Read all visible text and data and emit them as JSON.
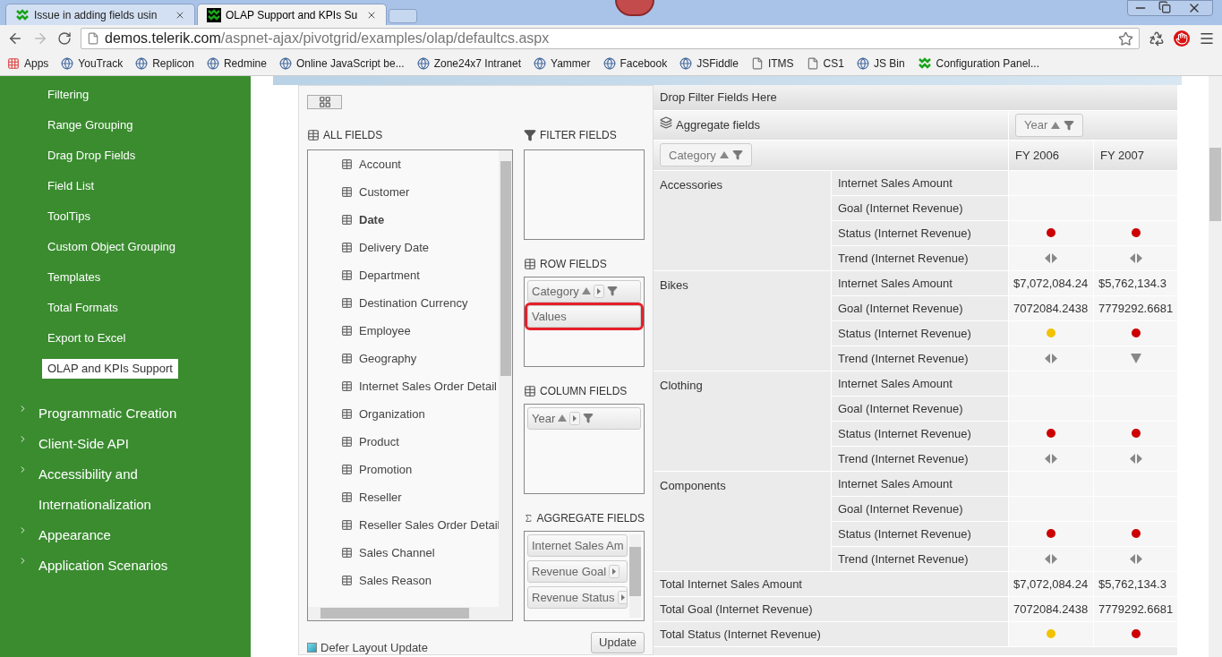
{
  "browser": {
    "tabs": [
      {
        "title": "Issue in adding fields usin",
        "selected": false
      },
      {
        "title": "OLAP Support and KPIs Su",
        "selected": true
      }
    ],
    "url_host": "demos.telerik.com",
    "url_path": "/aspnet-ajax/pivotgrid/examples/olap/defaultcs.aspx",
    "bookmarks": [
      {
        "label": "Apps",
        "kind": "apps"
      },
      {
        "label": "YouTrack",
        "kind": "site"
      },
      {
        "label": "Replicon",
        "kind": "site"
      },
      {
        "label": "Redmine",
        "kind": "site"
      },
      {
        "label": "Online JavaScript be...",
        "kind": "site"
      },
      {
        "label": "Zone24x7 Intranet",
        "kind": "site"
      },
      {
        "label": "Yammer",
        "kind": "site"
      },
      {
        "label": "Facebook",
        "kind": "site"
      },
      {
        "label": "JSFiddle",
        "kind": "site"
      },
      {
        "label": "ITMS",
        "kind": "page"
      },
      {
        "label": "CS1",
        "kind": "page"
      },
      {
        "label": "JS Bin",
        "kind": "site"
      },
      {
        "label": "Configuration Panel...",
        "kind": "logo"
      }
    ]
  },
  "sidebar": {
    "items": [
      {
        "label": "Filtering",
        "selected": false
      },
      {
        "label": "Range Grouping",
        "selected": false
      },
      {
        "label": "Drag Drop Fields",
        "selected": false
      },
      {
        "label": "Field List",
        "selected": false
      },
      {
        "label": "ToolTips",
        "selected": false
      },
      {
        "label": "Custom Object Grouping",
        "selected": false
      },
      {
        "label": "Templates",
        "selected": false
      },
      {
        "label": "Total Formats",
        "selected": false
      },
      {
        "label": "Export to Excel",
        "selected": false
      },
      {
        "label": "OLAP and KPIs Support",
        "selected": true
      }
    ],
    "sections": [
      {
        "label": "Programmatic Creation",
        "expanded": false
      },
      {
        "label": "Client-Side API",
        "expanded": false
      },
      {
        "label": "Accessibility and Internationalization",
        "expanded": false
      },
      {
        "label": "Appearance",
        "expanded": false
      },
      {
        "label": "Application Scenarios",
        "expanded": false
      }
    ]
  },
  "field_list": {
    "all_fields_title": "ALL FIELDS",
    "all_fields": [
      {
        "label": "Account",
        "bold": false
      },
      {
        "label": "Customer",
        "bold": false
      },
      {
        "label": "Date",
        "bold": true
      },
      {
        "label": "Delivery Date",
        "bold": false
      },
      {
        "label": "Department",
        "bold": false
      },
      {
        "label": "Destination Currency",
        "bold": false
      },
      {
        "label": "Employee",
        "bold": false
      },
      {
        "label": "Geography",
        "bold": false
      },
      {
        "label": "Internet Sales Order Detail",
        "bold": false
      },
      {
        "label": "Organization",
        "bold": false
      },
      {
        "label": "Product",
        "bold": false
      },
      {
        "label": "Promotion",
        "bold": false
      },
      {
        "label": "Reseller",
        "bold": false
      },
      {
        "label": "Reseller Sales Order Detail",
        "bold": false
      },
      {
        "label": "Sales Channel",
        "bold": false
      },
      {
        "label": "Sales Reason",
        "bold": false
      }
    ],
    "filter_title": "FILTER FIELDS",
    "row_title": "ROW FIELDS",
    "row_fields": [
      {
        "label": "Category",
        "kind": "field",
        "highlighted": false
      },
      {
        "label": "Values",
        "kind": "values",
        "highlighted": true
      }
    ],
    "column_title": "COLUMN FIELDS",
    "column_fields": [
      {
        "label": "Year",
        "kind": "field",
        "highlighted": false
      }
    ],
    "aggregate_title": "AGGREGATE FIELDS",
    "aggregate_fields": [
      {
        "label": "Internet Sales Am",
        "kind": "plain"
      },
      {
        "label": "Revenue Goal",
        "kind": "field"
      },
      {
        "label": "Revenue Status",
        "kind": "field"
      }
    ],
    "defer": {
      "label": "Defer Layout Update",
      "checked": false
    },
    "update_button": "Update"
  },
  "pivot": {
    "filter_zone": "Drop Filter Fields Here",
    "aggregate_label": "Aggregate fields",
    "column_field": "Year",
    "row_field": "Category",
    "columns": [
      "FY 2006",
      "FY 2007"
    ],
    "groups": [
      {
        "label": "Accessories",
        "rows": [
          {
            "measure": "Internet Sales Amount",
            "cells": [
              {
                "kind": "empty"
              },
              {
                "kind": "empty"
              }
            ]
          },
          {
            "measure": "Goal (Internet Revenue)",
            "cells": [
              {
                "kind": "empty"
              },
              {
                "kind": "empty"
              }
            ]
          },
          {
            "measure": "Status (Internet Revenue)",
            "cells": [
              {
                "kind": "status",
                "color": "#cc0000"
              },
              {
                "kind": "status",
                "color": "#cc0000"
              }
            ]
          },
          {
            "measure": "Trend (Internet Revenue)",
            "cells": [
              {
                "kind": "flat"
              },
              {
                "kind": "flat"
              }
            ]
          }
        ]
      },
      {
        "label": "Bikes",
        "rows": [
          {
            "measure": "Internet Sales Amount",
            "cells": [
              {
                "kind": "text",
                "text": "$7,072,084.24"
              },
              {
                "kind": "text",
                "text": "$5,762,134.3"
              }
            ]
          },
          {
            "measure": "Goal (Internet Revenue)",
            "cells": [
              {
                "kind": "text",
                "text": "7072084.2438"
              },
              {
                "kind": "text",
                "text": "7779292.6681"
              }
            ]
          },
          {
            "measure": "Status (Internet Revenue)",
            "cells": [
              {
                "kind": "status",
                "color": "#f2c200"
              },
              {
                "kind": "status",
                "color": "#cc0000"
              }
            ]
          },
          {
            "measure": "Trend (Internet Revenue)",
            "cells": [
              {
                "kind": "flat"
              },
              {
                "kind": "down"
              }
            ]
          }
        ]
      },
      {
        "label": "Clothing",
        "rows": [
          {
            "measure": "Internet Sales Amount",
            "cells": [
              {
                "kind": "empty"
              },
              {
                "kind": "empty"
              }
            ]
          },
          {
            "measure": "Goal (Internet Revenue)",
            "cells": [
              {
                "kind": "empty"
              },
              {
                "kind": "empty"
              }
            ]
          },
          {
            "measure": "Status (Internet Revenue)",
            "cells": [
              {
                "kind": "status",
                "color": "#cc0000"
              },
              {
                "kind": "status",
                "color": "#cc0000"
              }
            ]
          },
          {
            "measure": "Trend (Internet Revenue)",
            "cells": [
              {
                "kind": "flat"
              },
              {
                "kind": "flat"
              }
            ]
          }
        ]
      },
      {
        "label": "Components",
        "rows": [
          {
            "measure": "Internet Sales Amount",
            "cells": [
              {
                "kind": "empty"
              },
              {
                "kind": "empty"
              }
            ]
          },
          {
            "measure": "Goal (Internet Revenue)",
            "cells": [
              {
                "kind": "empty"
              },
              {
                "kind": "empty"
              }
            ]
          },
          {
            "measure": "Status (Internet Revenue)",
            "cells": [
              {
                "kind": "status",
                "color": "#cc0000"
              },
              {
                "kind": "status",
                "color": "#cc0000"
              }
            ]
          },
          {
            "measure": "Trend (Internet Revenue)",
            "cells": [
              {
                "kind": "flat"
              },
              {
                "kind": "flat"
              }
            ]
          }
        ]
      }
    ],
    "totals": [
      {
        "label": "Total Internet Sales Amount",
        "cells": [
          {
            "kind": "text",
            "text": "$7,072,084.24"
          },
          {
            "kind": "text",
            "text": "$5,762,134.3"
          }
        ]
      },
      {
        "label": "Total Goal (Internet Revenue)",
        "cells": [
          {
            "kind": "text",
            "text": "7072084.2438"
          },
          {
            "kind": "text",
            "text": "7779292.6681"
          }
        ]
      },
      {
        "label": "Total Status (Internet Revenue)",
        "cells": [
          {
            "kind": "status",
            "color": "#f2c200"
          },
          {
            "kind": "status",
            "color": "#cc0000"
          }
        ]
      }
    ]
  }
}
